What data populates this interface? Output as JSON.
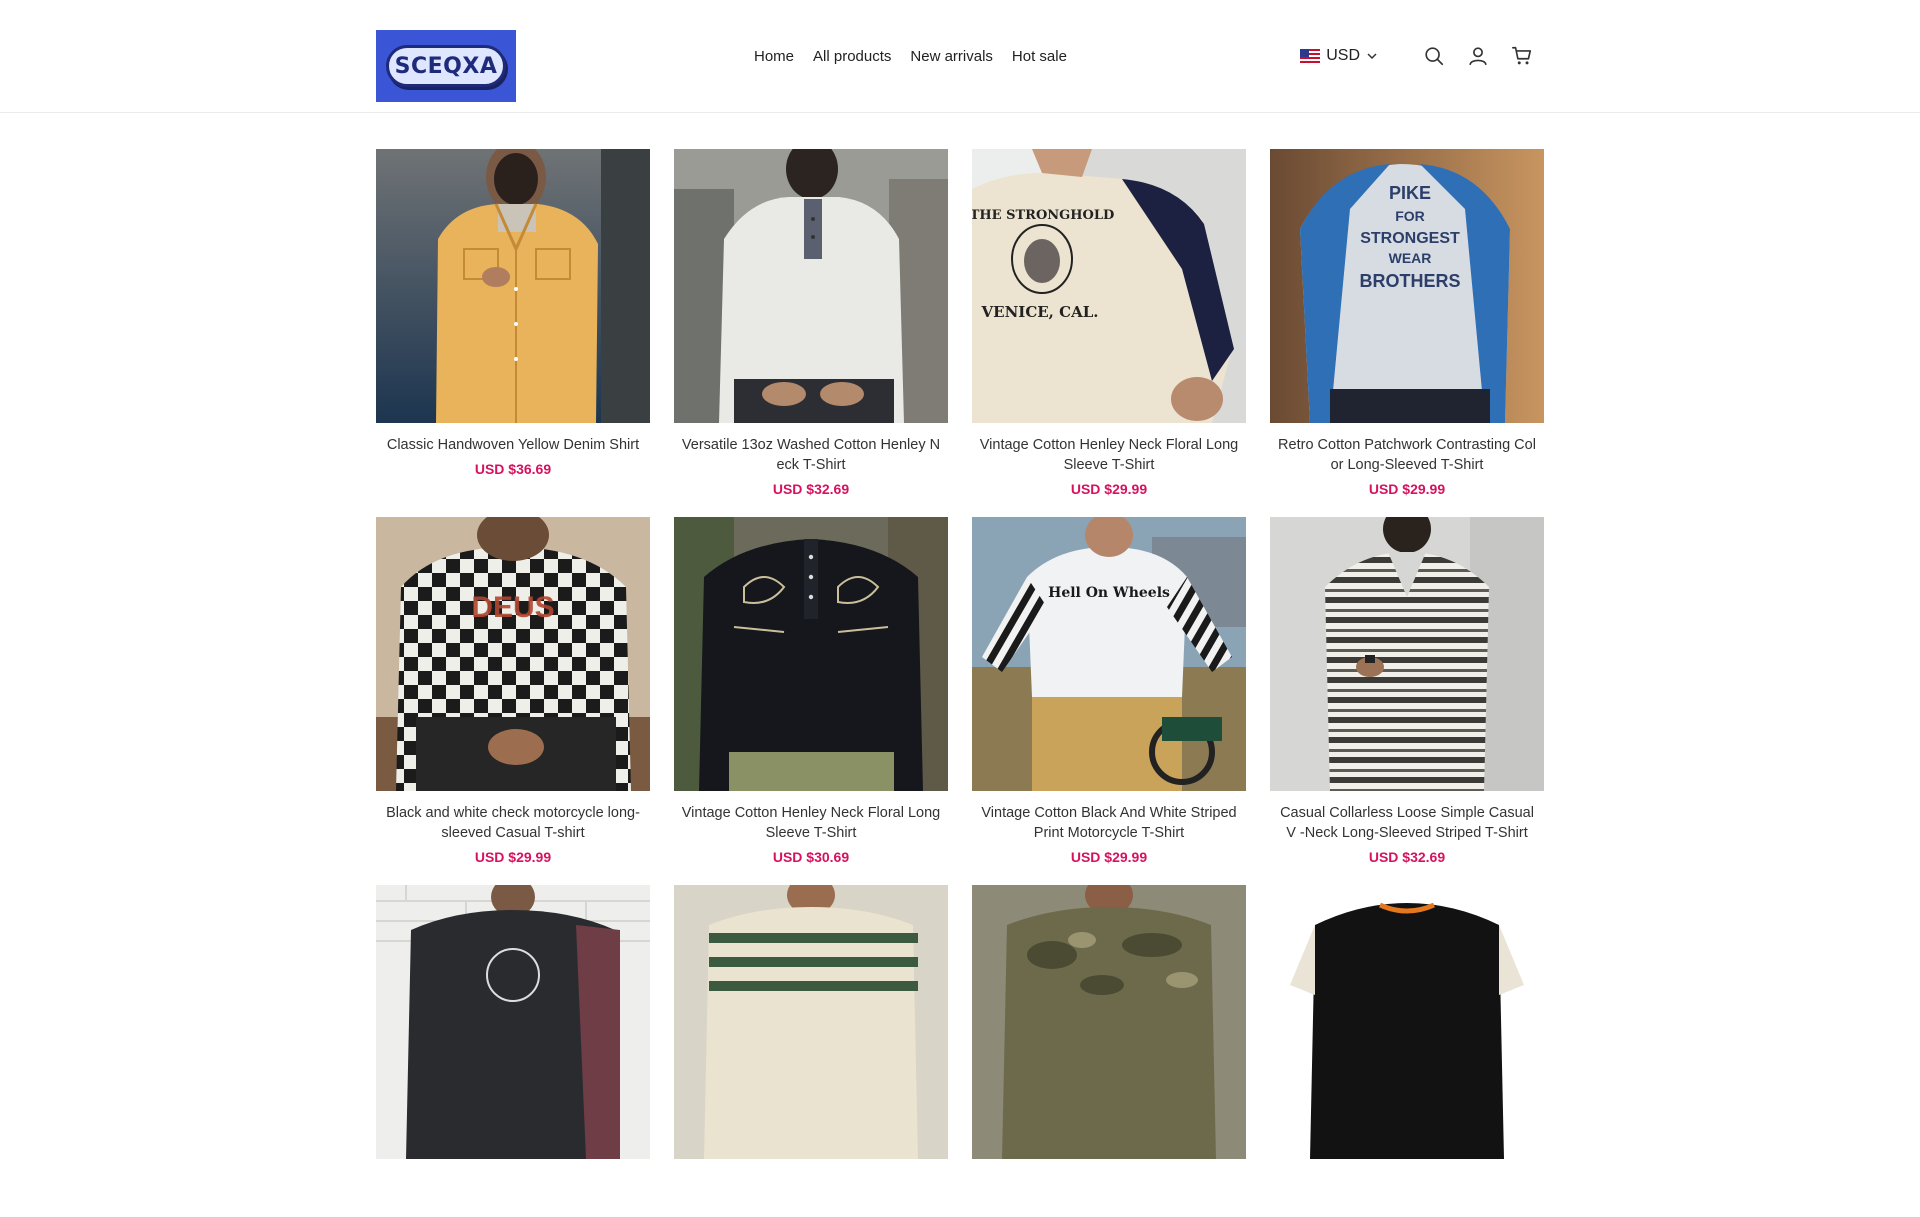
{
  "header": {
    "logo_text": "SCEQXA",
    "nav": [
      "Home",
      "All products",
      "New arrivals",
      "Hot sale"
    ],
    "currency": "USD",
    "icons": [
      "us-flag-icon",
      "chevron-down-icon",
      "search-icon",
      "user-icon",
      "cart-icon"
    ]
  },
  "products": [
    {
      "title": "Classic Handwoven Yellow Denim Shirt",
      "price": "USD $36.69"
    },
    {
      "title": "Versatile 13oz Washed Cotton Henley N eck T-Shirt",
      "price": "USD $32.69"
    },
    {
      "title": "Vintage Cotton Henley Neck Floral Long Sleeve T-Shirt",
      "price": "USD $29.99"
    },
    {
      "title": "Retro Cotton Patchwork Contrasting Col or Long-Sleeved T-Shirt",
      "price": "USD $29.99"
    },
    {
      "title": "Black and white check motorcycle long-sleeved Casual T-shirt",
      "price": "USD $29.99"
    },
    {
      "title": "Vintage Cotton Henley Neck Floral Long Sleeve T-Shirt",
      "price": "USD $30.69"
    },
    {
      "title": "Vintage Cotton Black And White Striped Print Motorcycle T-Shirt",
      "price": "USD $29.99"
    },
    {
      "title": "Casual Collarless Loose Simple Casual V -Neck Long-Sleeved Striped T-Shirt",
      "price": "USD $32.69"
    },
    {
      "title": "",
      "price": ""
    },
    {
      "title": "",
      "price": ""
    },
    {
      "title": "",
      "price": ""
    },
    {
      "title": "",
      "price": ""
    }
  ],
  "image_text": {
    "p3_print": [
      "THE STRONGHOLD",
      "VENICE, CAL."
    ],
    "p4_print": [
      "PIKE",
      "FOR",
      "STRONGEST",
      "WEAR",
      "BROTHERS"
    ]
  },
  "colors": {
    "price": "#d6125f",
    "logo_bg": "#3a55d6"
  }
}
